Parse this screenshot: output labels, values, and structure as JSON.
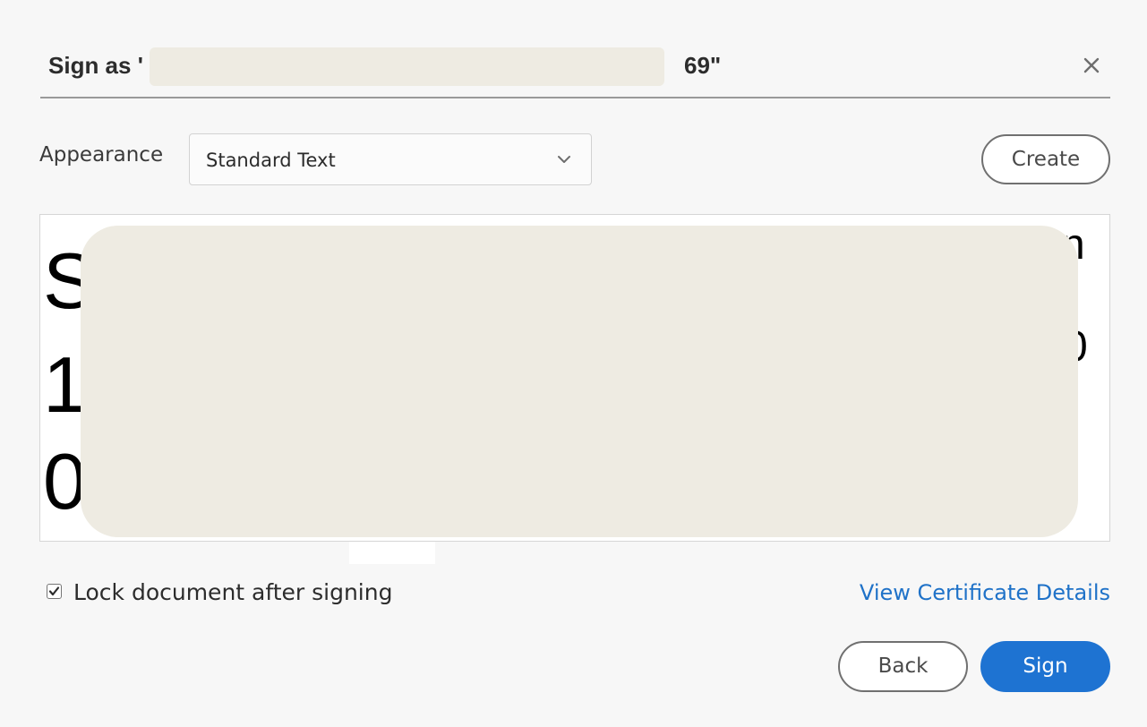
{
  "dialog": {
    "title_prefix": "Sign as '",
    "title_suffix": "69\"",
    "close_icon": "close-icon"
  },
  "appearance": {
    "label": "Appearance",
    "selected": "Standard Text",
    "chevron_icon": "chevron-down-icon",
    "create_label": "Create"
  },
  "preview": {
    "lines_left": [
      "S",
      "1",
      "0"
    ],
    "lines_right": [
      "n",
      "0"
    ]
  },
  "options": {
    "lock_label": "Lock document after signing",
    "lock_checked": true,
    "view_certificate_label": "View Certificate Details"
  },
  "footer": {
    "back_label": "Back",
    "sign_label": "Sign"
  },
  "colors": {
    "accent": "#1e73d2",
    "link": "#1f72c8",
    "redaction": "#eeebe2",
    "background": "#f7f7f7"
  }
}
